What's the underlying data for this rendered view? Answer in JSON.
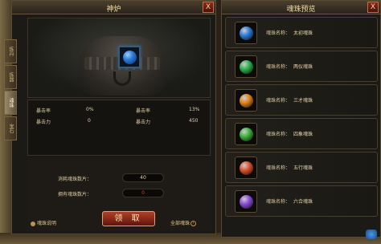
{
  "left_window": {
    "title": "神炉",
    "close_label": "X",
    "side_tabs": [
      "炼丹",
      "炼器",
      "魂珠",
      "宝石"
    ],
    "stats": {
      "left_label_1": "暴击率",
      "left_value_1": "0%",
      "left_label_2": "暴击力",
      "left_value_2": "0",
      "right_label_1": "暴击率",
      "right_value_1": "13%",
      "right_label_2": "暴击力",
      "right_value_2": "450"
    },
    "consume_label": "消耗魂珠数片：",
    "consume_value": "40",
    "own_label": "拥有魂珠数片：",
    "own_value": "0",
    "claim_button": "领 取",
    "help_link": "魂珠说明",
    "all_preview_link": "全部魂珠",
    "all_preview_arrow": "›"
  },
  "right_window": {
    "title": "魂珠预览",
    "close_label": "X",
    "items": [
      {
        "label": "魂珠名称：",
        "name": "太初魂珠",
        "color": "#2a7ad8"
      },
      {
        "label": "魂珠名称：",
        "name": "两仪魂珠",
        "color": "#2ab04a"
      },
      {
        "label": "魂珠名称：",
        "name": "三才魂珠",
        "color": "#e0801a"
      },
      {
        "label": "魂珠名称：",
        "name": "四象魂珠",
        "color": "#3ab03a"
      },
      {
        "label": "魂珠名称：",
        "name": "五行魂珠",
        "color": "#d8502a"
      },
      {
        "label": "魂珠名称：",
        "name": "六合魂珠",
        "color": "#8a4ad8"
      }
    ]
  }
}
